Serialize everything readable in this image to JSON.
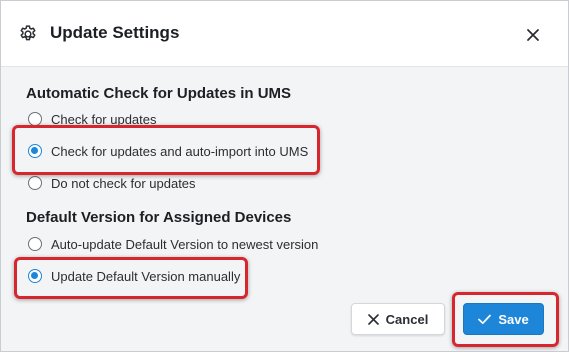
{
  "dialog": {
    "title": "Update Settings",
    "icon": "gear-icon",
    "close_icon": "close-icon"
  },
  "sections": [
    {
      "title": "Automatic Check for Updates in UMS",
      "options": [
        {
          "label": "Check for updates",
          "selected": false
        },
        {
          "label": "Check for updates and auto-import into UMS",
          "selected": true
        },
        {
          "label": "Do not check for updates",
          "selected": false
        }
      ]
    },
    {
      "title": "Default Version for Assigned Devices",
      "options": [
        {
          "label": "Auto-update Default Version to newest version",
          "selected": false
        },
        {
          "label": "Update Default Version manually",
          "selected": true
        }
      ]
    }
  ],
  "buttons": {
    "cancel_label": "Cancel",
    "save_label": "Save"
  },
  "colors": {
    "accent": "#1e86d8",
    "highlight": "#d7262e",
    "panel_background": "#f3f4f6"
  }
}
